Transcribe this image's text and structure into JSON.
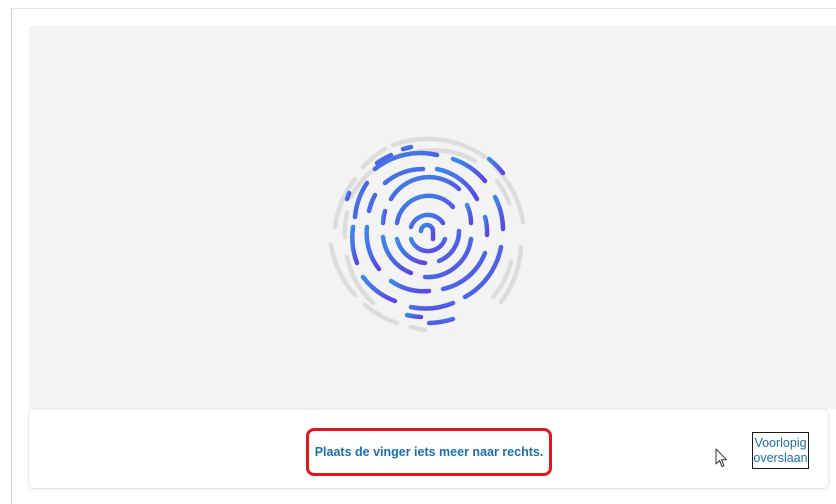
{
  "scan": {
    "instruction": "Plaats de vinger iets meer naar rechts.",
    "fingerprint_icon": "fingerprint-icon",
    "progress_colors": [
      "#3f84e6",
      "#5a4fe6"
    ],
    "pending_color": "#dcdcdc"
  },
  "actions": {
    "skip_label": "Voorlopig overslaan"
  },
  "colors": {
    "instruction_text": "#1a6fb0",
    "highlight_border": "#e8141c",
    "panel_background": "#f3f3f3"
  },
  "cursor_icon": "mouse-pointer-icon"
}
